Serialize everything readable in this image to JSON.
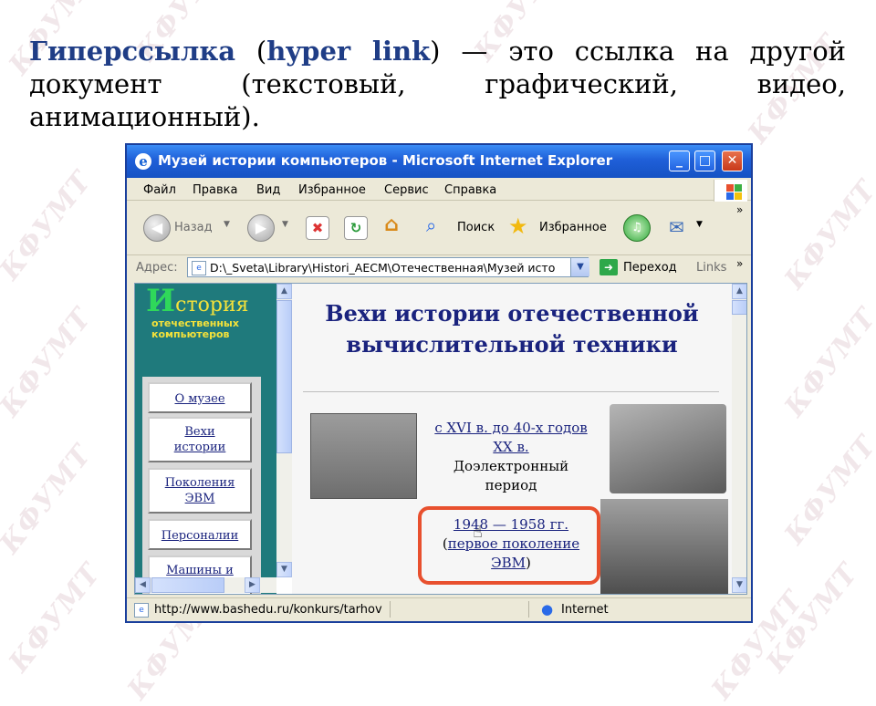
{
  "watermark": "КФУМТ",
  "heading": {
    "term": "Гиперссылка",
    "open_paren": " (",
    "term_en": "hyper link",
    "rest": ") — это ссылка на другой документ (текстовый, графический, видео, анимационный)."
  },
  "browser": {
    "title": "Музей истории компьютеров - Microsoft Internet Explorer",
    "window_buttons": [
      "_",
      "□",
      "✕"
    ],
    "menu": [
      "Файл",
      "Правка",
      "Вид",
      "Избранное",
      "Сервис",
      "Справка"
    ],
    "toolbar": {
      "back": "Назад",
      "search": "Поиск",
      "favorites": "Избранное",
      "chevron": "»"
    },
    "address": {
      "label": "Адрес:",
      "url": "D:\\_Sveta\\Library\\Histori_AECM\\Отечественная\\Музей исто",
      "go": "Переход",
      "links": "Links",
      "chevron": "»"
    },
    "status": {
      "url": "http://www.bashedu.ru/konkurs/tarhov",
      "zone": "Internet"
    }
  },
  "page": {
    "logo": {
      "letter": "И",
      "rest": "стория",
      "line2": "отечественных",
      "line3": "компьютеров"
    },
    "nav": [
      "О музее",
      "Вехи истории",
      "Поколения ЭВМ",
      "Персоналии",
      "Машины и"
    ],
    "title": "Вехи истории отечественной вычислительной техники",
    "period1": {
      "link": "с XVI в. до 40-х годов XX в.",
      "text": "Доэлектронный период"
    },
    "period2": {
      "link": "1948 — 1958 гг.",
      "sublink": "первое поколение ЭВМ",
      "open": "(",
      "close": ")"
    }
  },
  "colors": {
    "heading_accent": "#1f3d86",
    "title_bar": "#1f5fd8",
    "highlight_box": "#e8502e",
    "left_frame": "#1f7a7c"
  }
}
